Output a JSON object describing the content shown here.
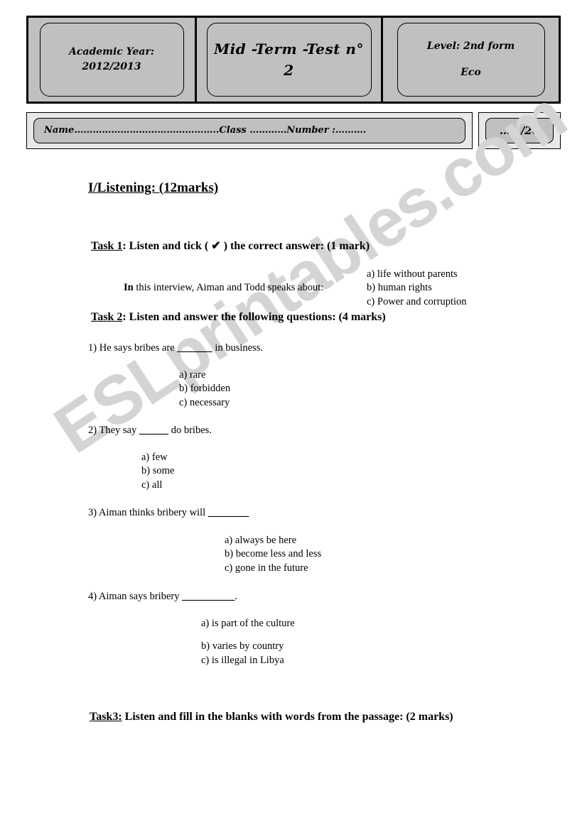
{
  "header": {
    "cells": [
      {
        "lines": [
          "Academic Year: 2012/2013"
        ]
      },
      {
        "lines": [
          "Mid -Term -Test n° 2"
        ]
      },
      {
        "lines": [
          "Level: 2nd form",
          "Eco"
        ]
      }
    ],
    "name_line": "Name………………………………………..Class …………Number :……….",
    "score": "……/20"
  },
  "section": {
    "title": "I/Listening: (12marks)"
  },
  "tasks": {
    "task1": {
      "label": "Task 1",
      "rest": ": Listen and tick ( ✔ ) the correct answer:  (1 mark)",
      "prompt_bold": "In",
      "prompt_rest": " this interview, Aiman and Todd speaks about:",
      "options": [
        "a) life without parents",
        "b) human rights",
        "c) Power and corruption"
      ]
    },
    "task2": {
      "label": "Task 2",
      "rest": ": Listen and answer the following questions: (4 marks)",
      "questions": [
        {
          "number": "1)",
          "pre": " He says bribes are ",
          "blank": "______",
          "post": " in business.",
          "options": [
            "a) rare",
            "b) forbidden",
            "c) necessary"
          ]
        },
        {
          "number": "2)",
          "pre": " They say ",
          "blank": "_____",
          "post": " do bribes.",
          "options": [
            "a) few",
            "b) some",
            "c) all"
          ]
        },
        {
          "number": "3)",
          "pre": " Aiman thinks bribery will ",
          "blank": "_______",
          "post": "",
          "options": [
            "a) always be here",
            "b) become less and less",
            "c) gone in the future"
          ]
        },
        {
          "number": "4)",
          "pre": " Aiman says bribery ",
          "blank": "_________",
          "post": ".",
          "options": [
            "a) is part of the culture",
            "b) varies by country",
            "c) is illegal in Libya"
          ]
        }
      ]
    },
    "task3": {
      "label": "Task3:",
      "rest": " Listen and fill in the blanks with words from the passage: (2 marks)"
    }
  },
  "watermark": {
    "text": "ESLprintables.com"
  }
}
